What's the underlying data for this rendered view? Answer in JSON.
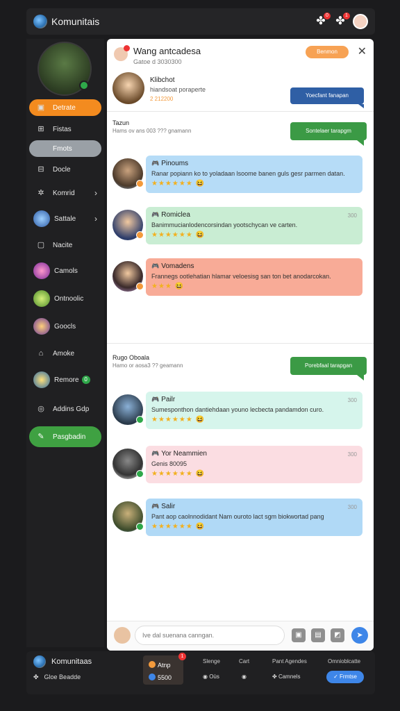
{
  "topbar": {
    "title": "Komunitais",
    "badge1": "0",
    "badge2": "1"
  },
  "sidebar": {
    "items": [
      {
        "label": "Detrate",
        "icon": "calendar-icon"
      },
      {
        "label": "Fistas",
        "icon": "cart-icon"
      },
      {
        "label": "Fmots",
        "icon": ""
      },
      {
        "label": "Docle",
        "icon": "grid-icon"
      },
      {
        "label": "Komrid",
        "icon": "gear-icon"
      },
      {
        "label": "Sattale",
        "icon": "game-icon"
      },
      {
        "label": "Nacite",
        "icon": "square-icon"
      },
      {
        "label": "Camols",
        "icon": "game-icon"
      },
      {
        "label": "Ontnoolic",
        "icon": "game-icon"
      },
      {
        "label": "Goocls",
        "icon": "game-icon"
      },
      {
        "label": "Amoke",
        "icon": "home-icon"
      },
      {
        "label": "Remore",
        "badge": "0",
        "icon": "game-icon"
      },
      {
        "label": "Addins Gdp",
        "icon": "at-icon"
      },
      {
        "label": "Pasgbadin",
        "icon": "chat-icon"
      }
    ]
  },
  "panel": {
    "title": "Wang antcadesa",
    "subtitle": "Gatoe d 3030300",
    "header_button": "Benmon",
    "highlight": {
      "name": "Klibchot",
      "text": "hiandsoat poraperte",
      "stamp": "2 212200",
      "bubble": "Yoecfant fanapan"
    },
    "section1": {
      "title": "Tazun",
      "subtitle": "Hams ov ans 003 ??? gnamann",
      "bubble": "Sontelaer tarapgm"
    },
    "section2": {
      "title": "Rugo Oboala",
      "subtitle": "Hamo or aosa3 ?? geamann",
      "bubble": "Porebfaal tarapgan"
    },
    "messages1": [
      {
        "name": "Pinoums",
        "time": "",
        "text": "Ranar popiann ko to yoladaan lsoome banen guls gesr parmen datan.",
        "stars": "★★★★★★",
        "emoji": "😆"
      },
      {
        "name": "Romiclea",
        "time": "300",
        "text": "Banimmucianlodencorsindan yootschycan ve carten.",
        "stars": "★★★★★★",
        "emoji": "😆"
      },
      {
        "name": "Vomadens",
        "time": "",
        "text": "Frannegs ootlehatian hlamar veloesisg san ton bet anodarcokan.",
        "stars": "★★★",
        "emoji": "😆"
      }
    ],
    "messages2": [
      {
        "name": "Pailr",
        "time": "300",
        "text": "Sumesponthon dantiehdaan youno lecbecta pandamdon curo.",
        "stars": "★★★★★★",
        "emoji": "😆"
      },
      {
        "name": "Yor Neammien",
        "time": "300",
        "text": "Genis 80095",
        "stars": "★★★★★★",
        "emoji": "😆"
      },
      {
        "name": "Salir",
        "time": "300",
        "text": "Pant aop caolnnodidant Nam ouroto lact sgm biokwortad pang",
        "stars": "★★★★★★",
        "emoji": "😆"
      }
    ],
    "composer": {
      "placeholder": "Ive dal suenana canngan."
    }
  },
  "bottombar": {
    "title": "Komunitaas",
    "subtitle": "Gloe Beadde",
    "card": {
      "line1": "Atnp",
      "line2": "5500",
      "badge": "1"
    },
    "cols": [
      {
        "top": "Slenge",
        "bottom": "Oùs"
      },
      {
        "top": "Cart",
        "bottom": ""
      },
      {
        "top": "Pant Agendes",
        "bottom": "Camnels"
      },
      {
        "top": "Omnioblcatte",
        "bottom": ""
      }
    ],
    "button": "Frmtse"
  }
}
